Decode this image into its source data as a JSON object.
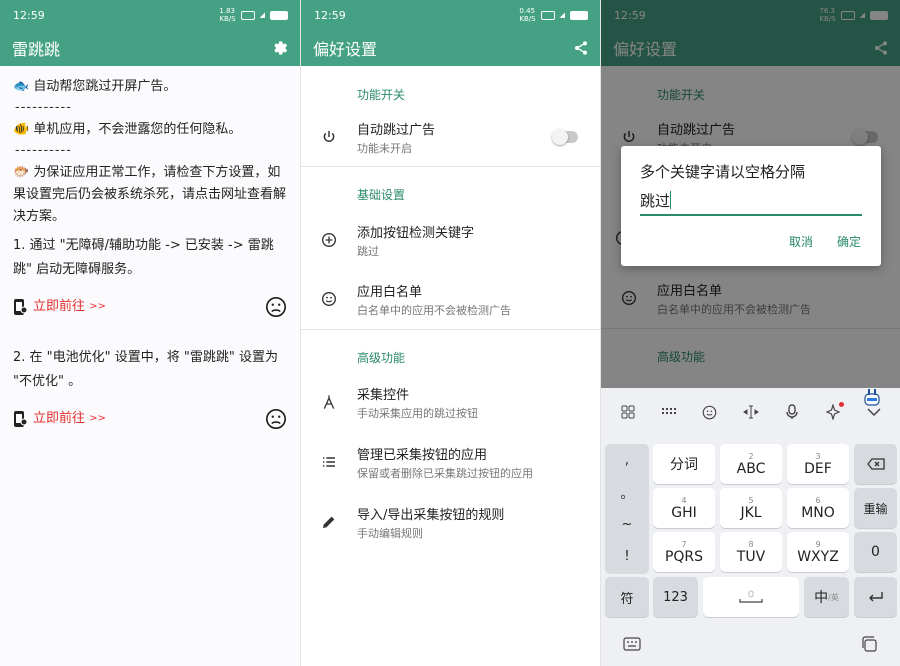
{
  "status_time": "12:59",
  "status_speed_1": "1.83",
  "status_speed_2": "0.45",
  "status_speed_3": "76.3",
  "status_unit": "KB/S",
  "battery": "100",
  "panel1": {
    "title": "雷跳跳",
    "para1": "自动帮您跳过开屏广告。",
    "dash": "----------",
    "para2": "单机应用，不会泄露您的任何隐私。",
    "para3": "为保证应用正常工作，请检查下方设置，如果设置完后仍会被系统杀死，请点击网址查看解决方案。",
    "step1": "1. 通过 \"无障碍/辅助功能 -> 已安装 -> 雷跳跳\" 启动无障碍服务。",
    "go1": "立即前往",
    "step2": "2. 在 \"电池优化\" 设置中，将 \"雷跳跳\" 设置为 \"不优化\" 。",
    "go2": "立即前往",
    "arrow": ">>"
  },
  "panel2": {
    "title": "偏好设置",
    "sec1": "功能开关",
    "item1_title": "自动跳过广告",
    "item1_sub": "功能未开启",
    "sec2": "基础设置",
    "item2_title": "添加按钮检测关键字",
    "item2_sub": "跳过",
    "item3_title": "应用白名单",
    "item3_sub": "白名单中的应用不会被检测广告",
    "sec3": "高级功能",
    "item4_title": "采集控件",
    "item4_sub": "手动采集应用的跳过按钮",
    "item5_title": "管理已采集按钮的应用",
    "item5_sub": "保留或者删除已采集跳过按钮的应用",
    "item6_title": "导入/导出采集按钮的规则",
    "item6_sub": "手动编辑规则"
  },
  "panel3": {
    "title": "偏好设置",
    "sec1": "功能开关",
    "item1_title": "自动跳过广告",
    "item1_sub": "功能未开启",
    "item3_title": "应用白名单",
    "item3_sub": "白名单中的应用不会被检测广告",
    "sec3": "高级功能",
    "dialog_title": "多个关键字请以空格分隔",
    "dialog_value": "跳过",
    "cancel": "取消",
    "confirm": "确定"
  },
  "keyboard": {
    "side": [
      ",",
      "。",
      "~",
      "!"
    ],
    "k1": "分词",
    "k2": "ABC",
    "k3": "DEF",
    "k4": "GHI",
    "k5": "JKL",
    "k6": "MNO",
    "k7": "PQRS",
    "k8": "TUV",
    "k9": "WXYZ",
    "n2": "2",
    "n3": "3",
    "n4": "4",
    "n5": "5",
    "n6": "6",
    "n7": "7",
    "n8": "8",
    "n9": "9",
    "retype": "重输",
    "zero": "0",
    "sym": "符",
    "num": "123",
    "zh": "中",
    "zh_sub": "/英"
  },
  "colors": {
    "primary": "#45a184",
    "accent": "#2a8a6a",
    "link": "#e33030"
  }
}
